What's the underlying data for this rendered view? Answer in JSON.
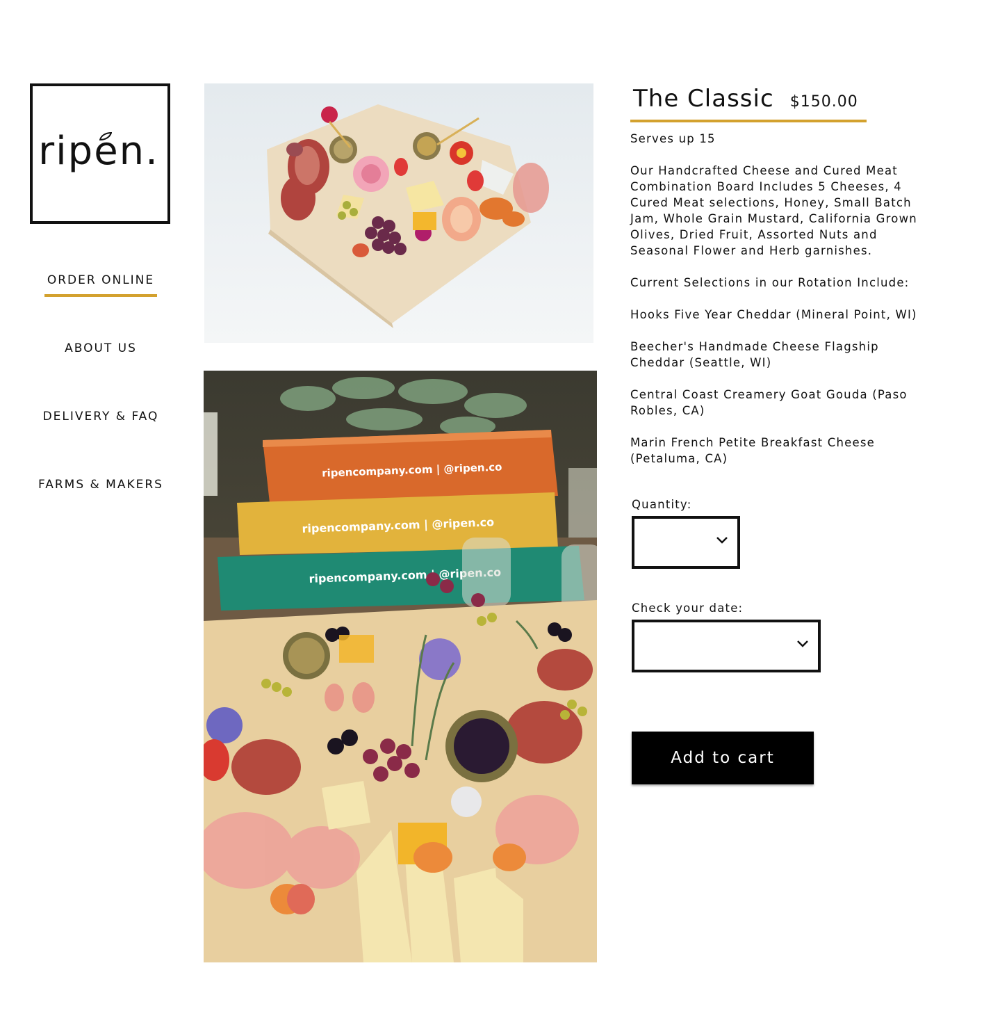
{
  "logo": {
    "text": "ripen."
  },
  "nav": {
    "items": [
      {
        "label": "ORDER ONLINE",
        "active": true
      },
      {
        "label": "ABOUT US",
        "active": false
      },
      {
        "label": "DELIVERY & FAQ",
        "active": false
      },
      {
        "label": "FARMS & MAKERS",
        "active": false
      }
    ]
  },
  "product": {
    "title": "The Classic",
    "price": "$150.00",
    "serves": "Serves up 15",
    "description": "Our Handcrafted Cheese and Cured Meat Combination Board Includes 5 Cheeses, 4 Cured Meat selections, Honey, Small Batch Jam, Whole Grain Mustard, California Grown Olives, Dried Fruit, Assorted Nuts and Seasonal Flower and Herb garnishes.",
    "selections_heading": "Current Selections in our Rotation Include:",
    "selections": [
      "Hooks Five Year Cheddar (Mineral Point, WI)",
      "Beecher's Handmade Cheese Flagship Cheddar (Seattle, WI)",
      "Central Coast Creamery Goat Gouda (Paso Robles, CA)",
      "Marin French Petite Breakfast Cheese (Petaluma, CA)"
    ]
  },
  "form": {
    "quantity_label": "Quantity:",
    "quantity_value": "",
    "date_label": "Check your date:",
    "date_value": "",
    "add_to_cart_label": "Add to cart"
  },
  "photos": {
    "box_print_top": "ripencompany.com | @ripen.co",
    "box_print_middle": "ripencompany.com | @ripen.co",
    "box_print_bottom": "ripencompany.com | @ripen.co"
  },
  "colors": {
    "accent": "#d3a12e",
    "text": "#111111",
    "button_bg": "#000000",
    "button_text": "#ffffff",
    "box_orange": "#d9692b",
    "box_yellow": "#e2b33c",
    "box_teal": "#1f8a73"
  }
}
